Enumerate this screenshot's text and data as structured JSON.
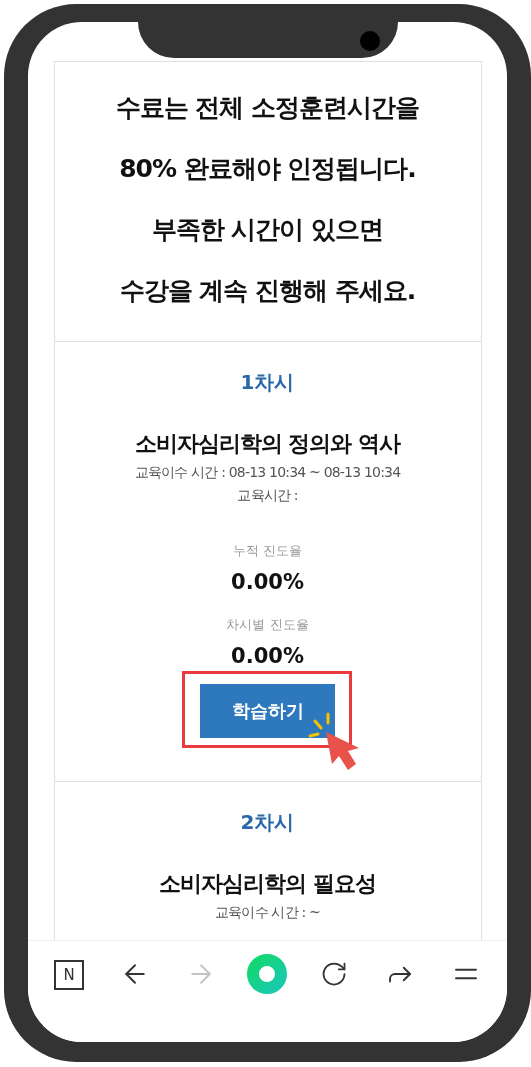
{
  "notice": {
    "lines": [
      "수료는 전체 소정훈련시간을",
      "80% 완료해야 인정됩니다.",
      "부족한 시간이 있으면",
      "수강을 계속 진행해 주세요."
    ]
  },
  "lessons": [
    {
      "number": "1차시",
      "title": "소비자심리학의 정의와 역사",
      "completion_time": "교육이수 시간 : 08-13 10:34 ~ 08-13 10:34",
      "study_time": "교육시간 :",
      "cumulative_label": "누적 진도율",
      "cumulative_value": "0.00%",
      "session_label": "차시별 진도율",
      "session_value": "0.00%",
      "button": "학습하기",
      "highlighted": true
    },
    {
      "number": "2차시",
      "title": "소비자심리학의 필요성",
      "completion_time": "교육이수 시간 : ~"
    }
  ],
  "toolbar": {
    "logo": "N",
    "items": [
      {
        "kind": "back",
        "disabled": false
      },
      {
        "kind": "forward",
        "disabled": true
      },
      {
        "kind": "home",
        "disabled": false
      },
      {
        "kind": "reload",
        "disabled": false
      },
      {
        "kind": "share",
        "disabled": false
      },
      {
        "kind": "menu",
        "disabled": false
      }
    ]
  }
}
